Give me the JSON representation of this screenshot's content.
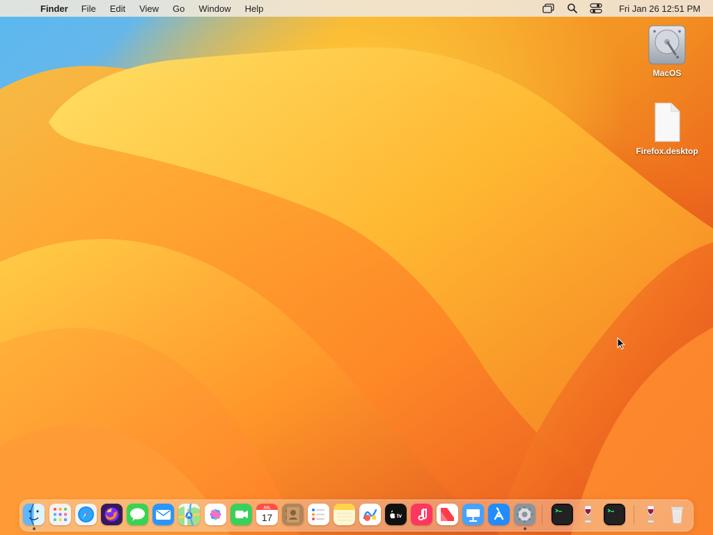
{
  "menubar": {
    "app_name": "Finder",
    "items": [
      "File",
      "Edit",
      "View",
      "Go",
      "Window",
      "Help"
    ],
    "status_icons": [
      "window-stack-icon",
      "search-icon",
      "control-center-icon"
    ],
    "clock": "Fri Jan 26  12:51 PM"
  },
  "desktop": {
    "icons": [
      {
        "label": "MacOS",
        "icon": "hard-drive-icon"
      },
      {
        "label": "Firefox.desktop",
        "icon": "document-icon"
      }
    ]
  },
  "dock": {
    "apps": [
      {
        "icon": "finder-icon"
      },
      {
        "icon": "launchpad-icon"
      },
      {
        "icon": "safari-icon"
      },
      {
        "icon": "firefox-icon"
      },
      {
        "icon": "messages-icon"
      },
      {
        "icon": "mail-icon"
      },
      {
        "icon": "maps-icon"
      },
      {
        "icon": "photos-icon"
      },
      {
        "icon": "facetime-icon"
      },
      {
        "icon": "calendar-icon",
        "month": "JUL",
        "day": "17"
      },
      {
        "icon": "contacts-icon"
      },
      {
        "icon": "reminders-icon"
      },
      {
        "icon": "notes-icon"
      },
      {
        "icon": "freeform-icon"
      },
      {
        "icon": "apple-tv-icon",
        "label": "tv"
      },
      {
        "icon": "music-icon"
      },
      {
        "icon": "news-icon"
      },
      {
        "icon": "keynote-icon"
      },
      {
        "icon": "app-store-icon"
      },
      {
        "icon": "system-settings-icon"
      },
      {
        "icon": "terminal-icon"
      },
      {
        "icon": "wine-icon"
      },
      {
        "icon": "terminal-icon"
      },
      {
        "icon": "wine-icon"
      },
      {
        "icon": "trash-icon"
      }
    ]
  },
  "colors": {
    "menubar_bg": "#f0e8dd",
    "wallpaper_orange": "#f39323",
    "wallpaper_blue": "#5ab8ef",
    "dock_bg": "#f4ede6"
  }
}
